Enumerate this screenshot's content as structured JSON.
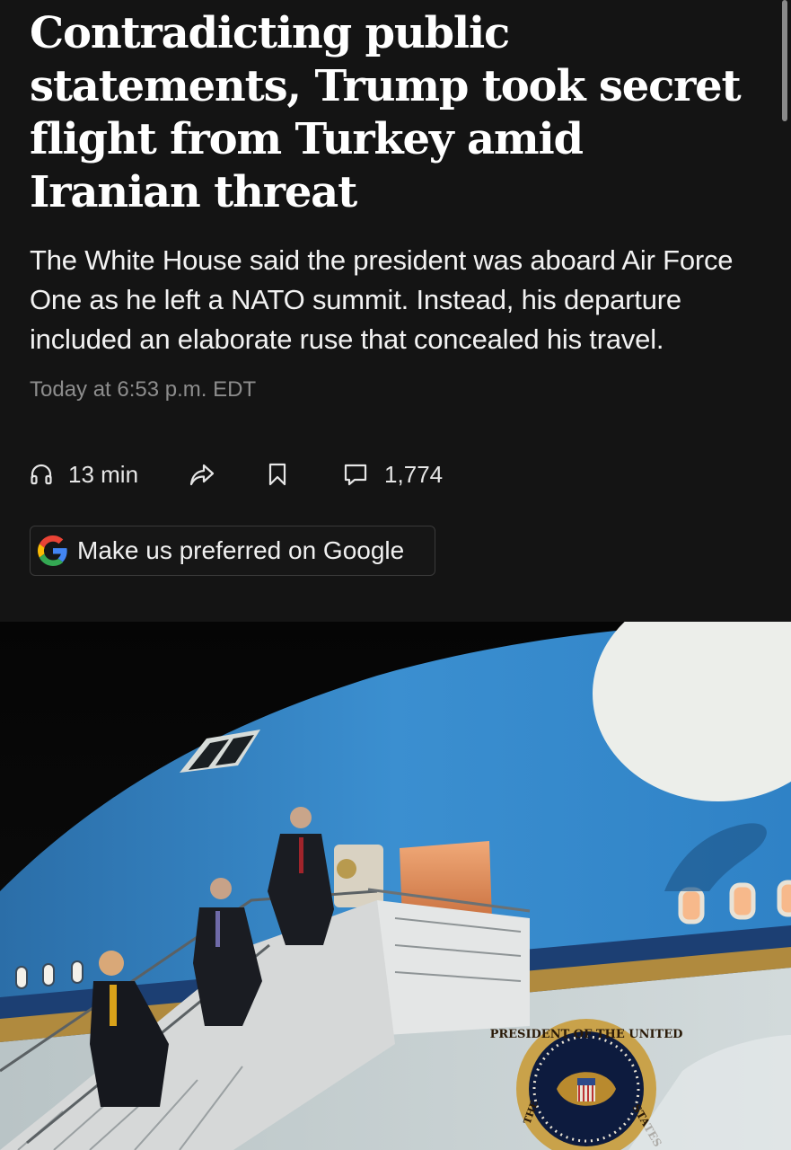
{
  "article": {
    "headline": "Contradicting public statements, Trump took secret flight from Turkey amid Iranian threat",
    "dek": "The White House said the president was aboard Air Force One as he left a NATO summit. Instead, his departure included an elaborate ruse that concealed his travel.",
    "timestamp": "Today at 6:53 p.m. EDT"
  },
  "actions": {
    "listen_label": "13 min",
    "listen_icon": "headphones-icon",
    "share_icon": "share-icon",
    "save_icon": "bookmark-icon",
    "comments_icon": "comment-icon",
    "comments_count": "1,774"
  },
  "google_button": {
    "label": "Make us preferred on Google",
    "icon": "google-logo-icon"
  },
  "photo": {
    "seal_top_text": "PRESIDENT OF THE UNITED",
    "seal_left_text": "THE",
    "seal_right_text": "STATES"
  },
  "colors": {
    "background": "#141414",
    "plane_blue": "#2f7fc4",
    "timestamp": "#8d8d8d"
  }
}
